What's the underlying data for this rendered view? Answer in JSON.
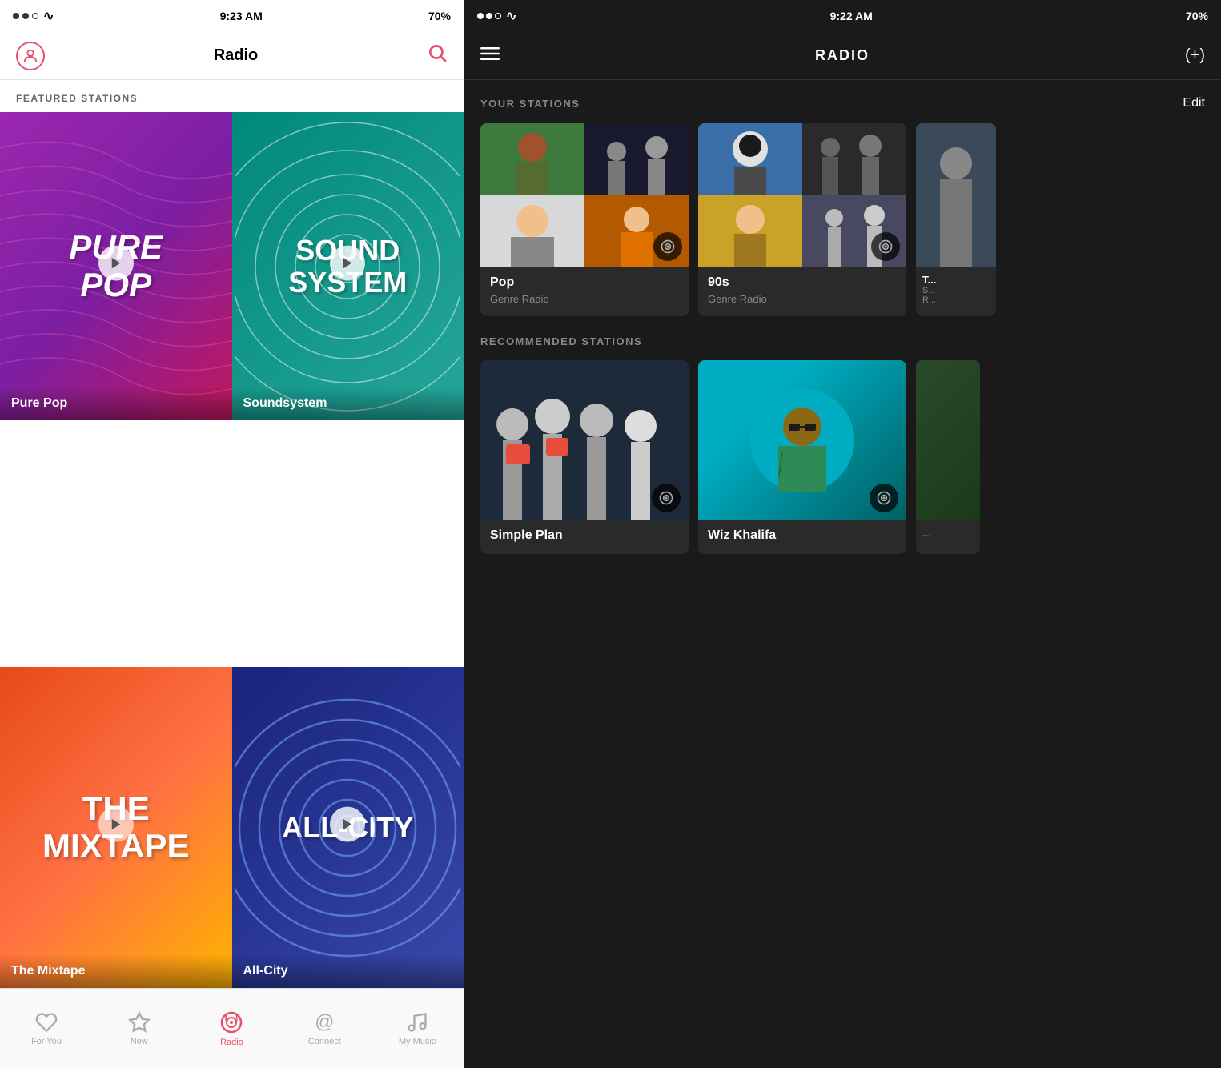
{
  "left": {
    "statusBar": {
      "time": "9:23 AM",
      "battery": "70%"
    },
    "header": {
      "title": "Radio"
    },
    "featuredLabel": "FEATURED STATIONS",
    "stations": [
      {
        "id": "pure-pop",
        "title": "Pure Pop",
        "artText": "PURE POP"
      },
      {
        "id": "soundsystem",
        "title": "Soundsystem",
        "artText": "SOUND SYSTEM"
      },
      {
        "id": "mixtape",
        "title": "The Mixtape",
        "artText": "THE MIXTAPE"
      },
      {
        "id": "allcity",
        "title": "All-City",
        "artText": "ALL-CITY"
      }
    ],
    "bottomNav": [
      {
        "id": "for-you",
        "label": "For You",
        "icon": "♡",
        "active": false
      },
      {
        "id": "new",
        "label": "New",
        "icon": "☆",
        "active": false
      },
      {
        "id": "radio",
        "label": "Radio",
        "icon": "📻",
        "active": true
      },
      {
        "id": "connect",
        "label": "Connect",
        "icon": "@",
        "active": false
      },
      {
        "id": "my-music",
        "label": "My Music",
        "icon": "♪",
        "active": false
      }
    ]
  },
  "right": {
    "statusBar": {
      "time": "9:22 AM",
      "battery": "70%"
    },
    "header": {
      "title": "RADIO"
    },
    "yourStations": {
      "sectionTitle": "YOUR STATIONS",
      "editLabel": "Edit",
      "stations": [
        {
          "id": "pop",
          "name": "Pop",
          "type": "Genre Radio"
        },
        {
          "id": "90s",
          "name": "90s",
          "type": "Genre Radio"
        }
      ]
    },
    "recommendedStations": {
      "sectionTitle": "RECOMMENDED STATIONS",
      "stations": [
        {
          "id": "simple-plan",
          "name": "Simple Plan"
        },
        {
          "id": "wiz-khalifa",
          "name": "Wiz Khalifa"
        }
      ]
    }
  }
}
